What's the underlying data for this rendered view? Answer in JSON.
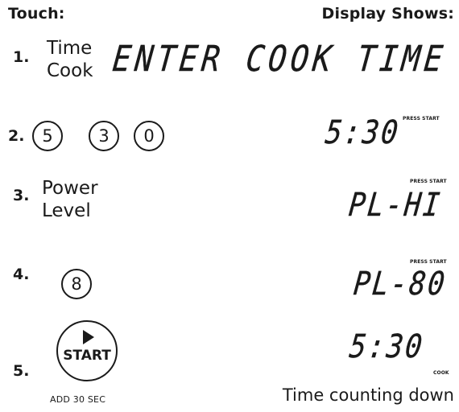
{
  "header": {
    "touch": "Touch:",
    "display": "Display Shows:"
  },
  "steps": [
    {
      "number": "1.",
      "touch_line1": "Time",
      "touch_line2": "Cook",
      "display": "ENTER COOK TIME"
    },
    {
      "number": "2.",
      "keys": [
        "5",
        "3",
        "0"
      ],
      "display": "5:30",
      "indicator": "PRESS START"
    },
    {
      "number": "3.",
      "touch_line1": "Power",
      "touch_line2": "Level",
      "display": "PL-HI",
      "indicator": "PRESS START"
    },
    {
      "number": "4.",
      "keys": [
        "8"
      ],
      "display": "PL-80",
      "indicator": "PRESS START"
    },
    {
      "number": "5.",
      "button_label": "START",
      "button_caption": "ADD 30 SEC",
      "display": "5:30",
      "indicator": "COOK",
      "note": "Time counting down"
    }
  ]
}
